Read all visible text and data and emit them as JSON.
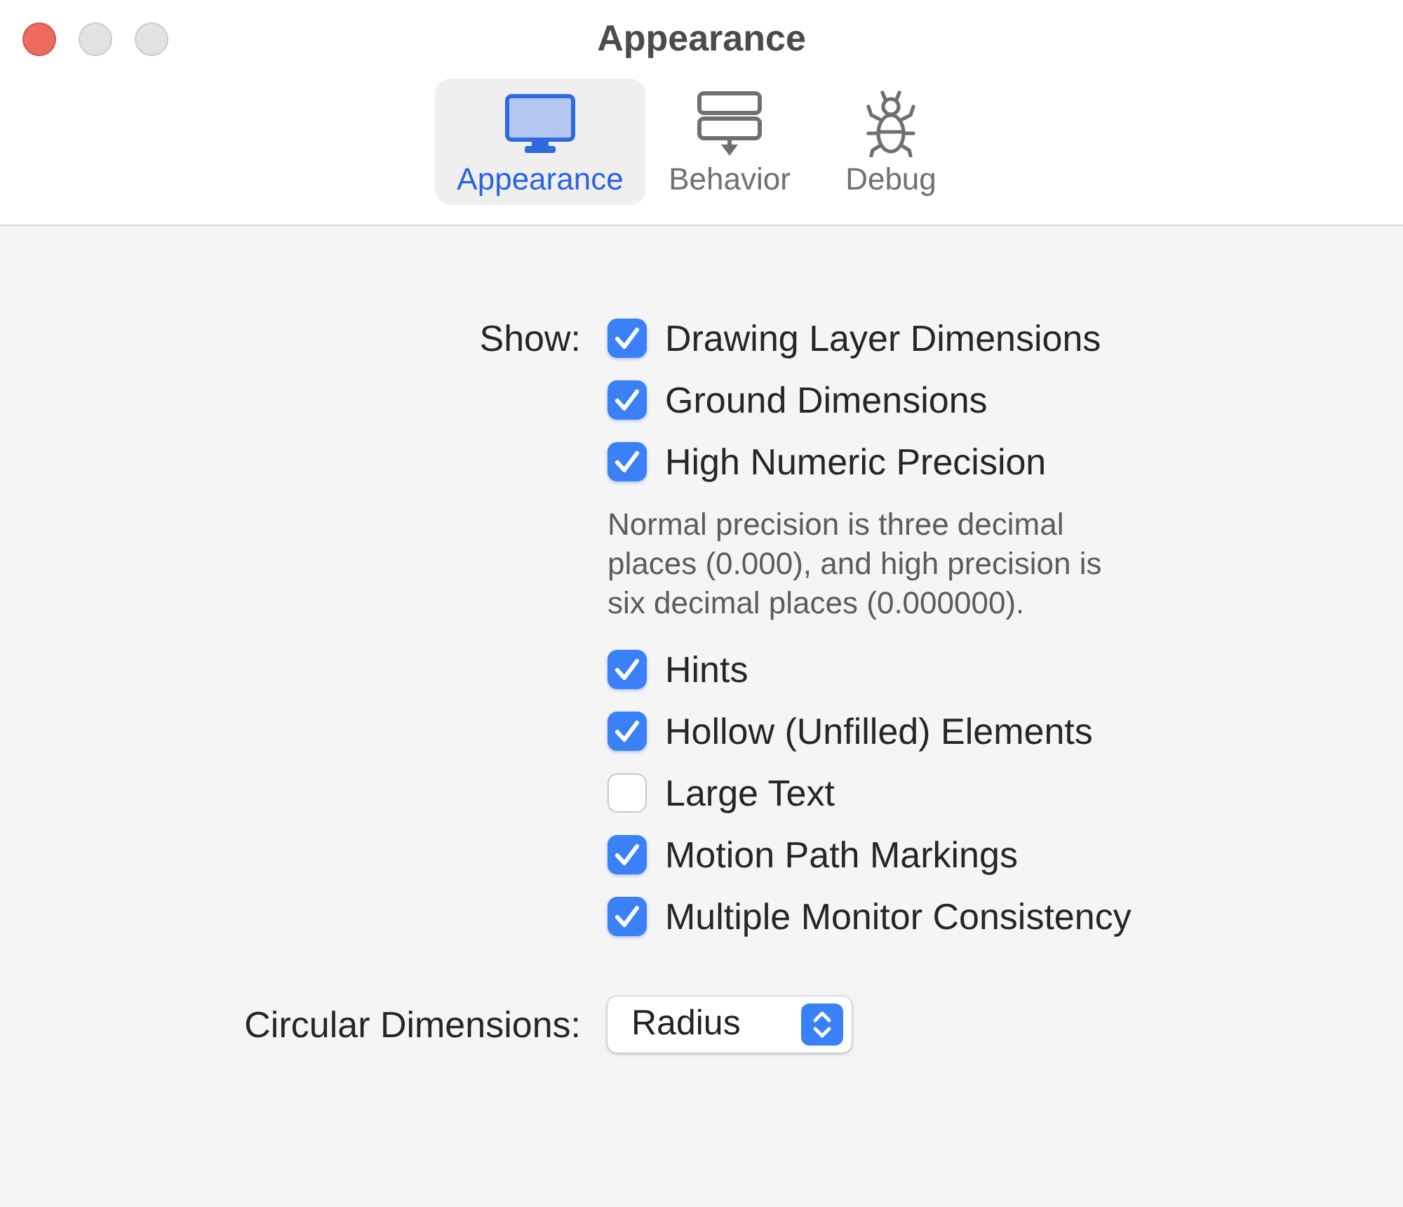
{
  "window": {
    "title": "Appearance",
    "buttons": [
      {
        "kind": "close",
        "disabled": false
      },
      {
        "kind": "minimize",
        "disabled": true
      },
      {
        "kind": "zoom",
        "disabled": true
      }
    ]
  },
  "tabs": [
    {
      "label": "Appearance",
      "selected": true
    },
    {
      "label": "Behavior",
      "selected": false
    },
    {
      "label": "Debug",
      "selected": false
    }
  ],
  "show": {
    "label": "Show:",
    "items": [
      {
        "kind": "checkbox",
        "label": "Drawing Layer Dimensions",
        "checked": true
      },
      {
        "kind": "checkbox",
        "label": "Ground Dimensions",
        "checked": true
      },
      {
        "kind": "checkbox",
        "label": "High Numeric Precision",
        "checked": true
      },
      {
        "kind": "note",
        "text": "Normal precision is three decimal places (0.000), and high precision is six decimal places (0.000000)."
      },
      {
        "kind": "checkbox",
        "label": "Hints",
        "checked": true
      },
      {
        "kind": "checkbox",
        "label": "Hollow (Unfilled) Elements",
        "checked": true
      },
      {
        "kind": "checkbox",
        "label": "Large Text",
        "checked": false
      },
      {
        "kind": "checkbox",
        "label": "Motion Path Markings",
        "checked": true
      },
      {
        "kind": "checkbox",
        "label": "Multiple Monitor Consistency",
        "checked": true
      }
    ]
  },
  "circular_dimensions": {
    "label": "Circular Dimensions:",
    "value": "Radius"
  }
}
